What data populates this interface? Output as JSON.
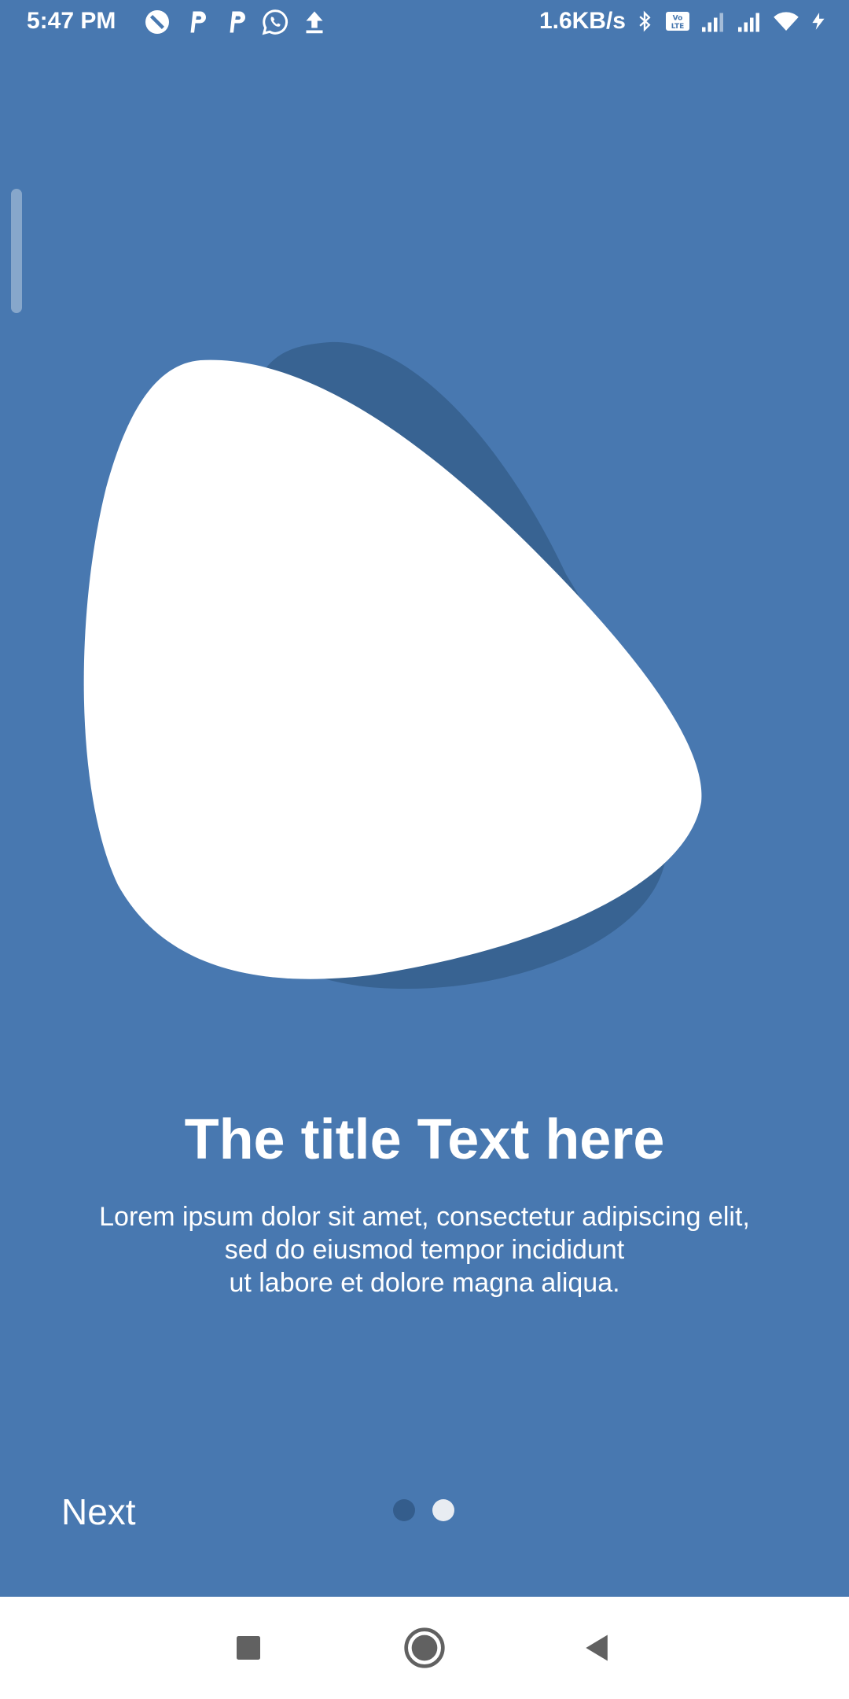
{
  "status_bar": {
    "time": "5:47 PM",
    "network_speed": "1.6KB/s",
    "left_icons": [
      "do-not-disturb-icon",
      "p-app-icon",
      "p-app-icon",
      "whatsapp-icon",
      "upload-icon"
    ],
    "right_icons": [
      "bluetooth-icon",
      "volte-icon",
      "cell-signal-icon",
      "cell-signal-icon",
      "wifi-icon",
      "charging-icon"
    ]
  },
  "onboarding": {
    "title": "The title Text here",
    "body_lines": [
      "Lorem ipsum dolor sit amet, consectetur adipiscing elit,",
      "sed do eiusmod tempor incididunt",
      "ut labore et dolore magna aliqua."
    ],
    "next_label": "Next",
    "page_count": 2,
    "current_page": 2
  },
  "colors": {
    "background": "#4878B0",
    "blob_shadow": "#386392",
    "blob": "#FFFFFF",
    "dot_inactive": "#345D8C",
    "dot_active": "#E8ECF2",
    "nav_bar": "#FFFFFF"
  },
  "nav_bar": {
    "buttons": [
      "recents-square-icon",
      "home-circle-icon",
      "back-triangle-icon"
    ]
  }
}
